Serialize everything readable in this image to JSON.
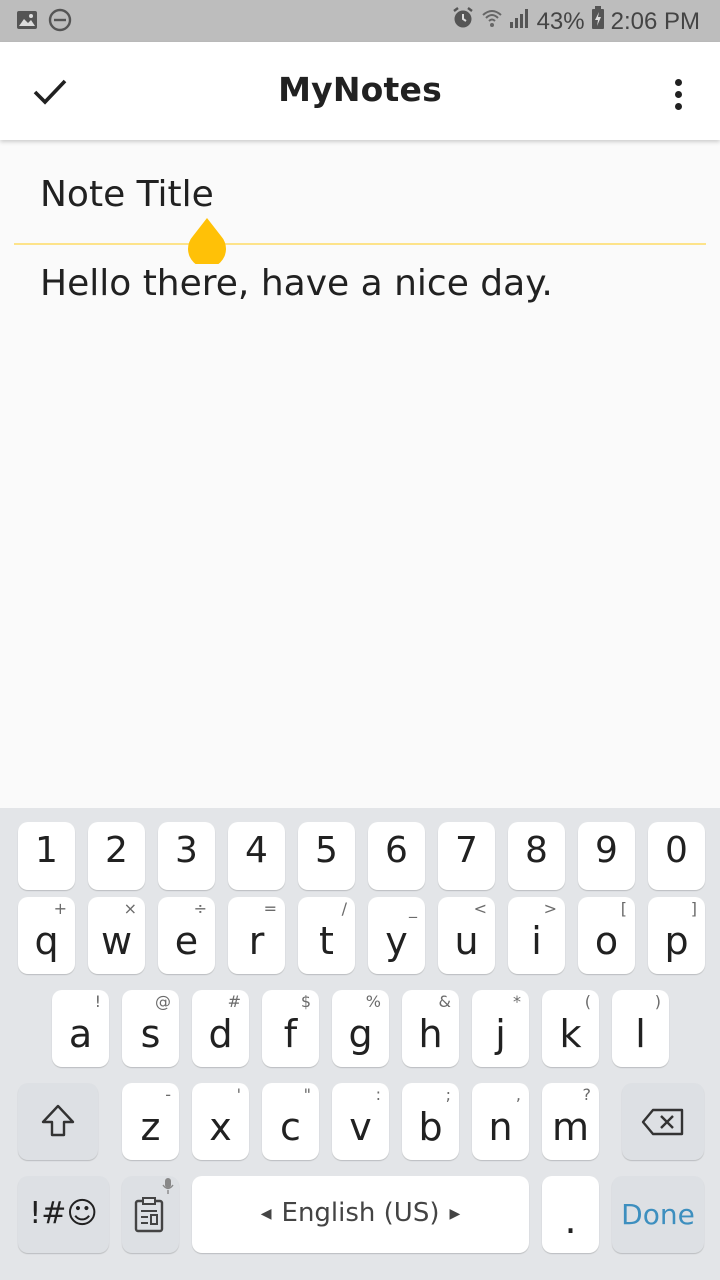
{
  "status_bar": {
    "battery": "43%",
    "time": "2:06 PM",
    "icons": [
      "image-icon",
      "dnd-icon",
      "alarm-icon",
      "wifi-icon",
      "signal-icon",
      "battery-charging-icon"
    ]
  },
  "app_bar": {
    "title": "MyNotes",
    "confirm_icon": "check-icon",
    "menu_icon": "more-vert-icon"
  },
  "note": {
    "title_placeholder": "Note Title",
    "body": "Hello there, have a nice day."
  },
  "colors": {
    "accent": "#ffc107",
    "underline": "#fde38a",
    "done_text": "#3d8fbf"
  },
  "keyboard": {
    "numbers": [
      "1",
      "2",
      "3",
      "4",
      "5",
      "6",
      "7",
      "8",
      "9",
      "0"
    ],
    "row1": [
      {
        "key": "q",
        "hint": "+"
      },
      {
        "key": "w",
        "hint": "×"
      },
      {
        "key": "e",
        "hint": "÷"
      },
      {
        "key": "r",
        "hint": "="
      },
      {
        "key": "t",
        "hint": "/"
      },
      {
        "key": "y",
        "hint": "_"
      },
      {
        "key": "u",
        "hint": "<"
      },
      {
        "key": "i",
        "hint": ">"
      },
      {
        "key": "o",
        "hint": "["
      },
      {
        "key": "p",
        "hint": "]"
      }
    ],
    "row2": [
      {
        "key": "a",
        "hint": "!"
      },
      {
        "key": "s",
        "hint": "@"
      },
      {
        "key": "d",
        "hint": "#"
      },
      {
        "key": "f",
        "hint": "$"
      },
      {
        "key": "g",
        "hint": "%"
      },
      {
        "key": "h",
        "hint": "&"
      },
      {
        "key": "j",
        "hint": "*"
      },
      {
        "key": "k",
        "hint": "("
      },
      {
        "key": "l",
        "hint": ")"
      }
    ],
    "row3": [
      {
        "key": "z",
        "hint": "-"
      },
      {
        "key": "x",
        "hint": "'"
      },
      {
        "key": "c",
        "hint": "\""
      },
      {
        "key": "v",
        "hint": ":"
      },
      {
        "key": "b",
        "hint": ";"
      },
      {
        "key": "n",
        "hint": ","
      },
      {
        "key": "m",
        "hint": "?"
      }
    ],
    "symbols_label": "!#☺",
    "space_label": "English (US)",
    "period_label": ".",
    "done_label": "Done"
  }
}
